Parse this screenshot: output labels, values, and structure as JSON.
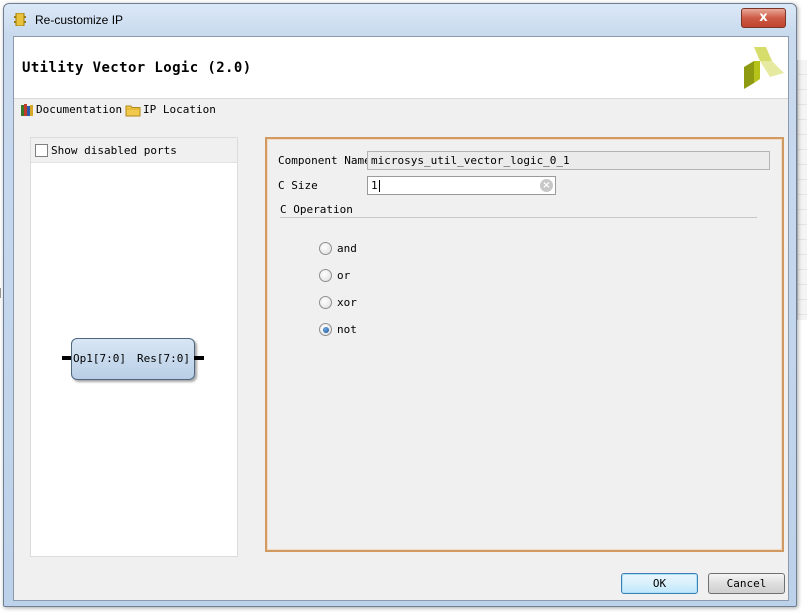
{
  "window": {
    "title": "Re-customize IP",
    "close_symbol": "x",
    "close_icon": "close-icon",
    "title_icon": "vivado-ip-icon"
  },
  "header": {
    "ip_name": "Utility Vector Logic (2.0)",
    "logo_icon": "xilinx-logo",
    "logo_color": "#b5c21a"
  },
  "links": {
    "documentation": "Documentation",
    "ip_location": "IP Location"
  },
  "symbol_panel": {
    "show_disabled_ports_label": "Show disabled ports",
    "show_disabled_ports_checked": false,
    "block": {
      "input_port": "Op1[7:0]",
      "output_port": "Res[7:0]"
    }
  },
  "config": {
    "component_name_label": "Component Name",
    "component_name_value": "microsys_util_vector_logic_0_1",
    "c_size_label": "C Size",
    "c_size_value": "1",
    "clear_symbol": "×",
    "c_operation_label": "C Operation",
    "operations": [
      {
        "label": "and",
        "checked": false
      },
      {
        "label": "or",
        "checked": false
      },
      {
        "label": "xor",
        "checked": false
      },
      {
        "label": "not",
        "checked": true
      }
    ],
    "accent_border_color": "#d09a62"
  },
  "footer": {
    "ok_label": "OK",
    "cancel_label": "Cancel"
  }
}
